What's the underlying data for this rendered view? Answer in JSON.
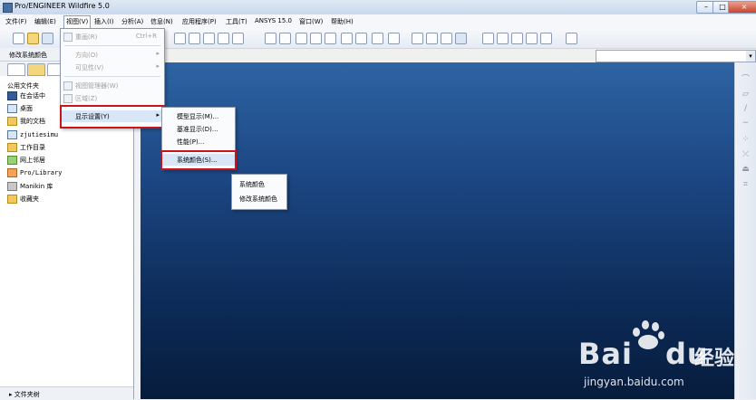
{
  "window": {
    "title": "Pro/ENGINEER Wildfire 5.0",
    "controls": [
      "–",
      "□",
      "×"
    ]
  },
  "menubar": [
    "文件(F)",
    "编辑(E)",
    "视图(V)",
    "插入(I)",
    "分析(A)",
    "信息(N)",
    "应用程序(P)",
    "工具(T)",
    "ANSYS 15.0",
    "窗口(W)",
    "帮助(H)"
  ],
  "left_panel": {
    "header": "修改系统颜色",
    "section": "公用文件夹",
    "items": [
      "在会话中",
      "桌面",
      "我的文档",
      "zjutiesimu",
      "工作目录",
      "网上邻居",
      "Pro/Library",
      "Manikin 库",
      "收藏夹"
    ],
    "footer": "▸ 文件夹树"
  },
  "view_menu": {
    "items": [
      {
        "label": "重画(R)",
        "shortcut": "Ctrl+R",
        "disabled": true
      },
      {
        "label": "方向(O)",
        "submenu": true,
        "disabled": true
      },
      {
        "label": "可见性(V)",
        "submenu": true,
        "disabled": true
      },
      {
        "label": "视图管理器(W)",
        "disabled": true
      },
      {
        "label": "区域(Z)",
        "disabled": true
      },
      {
        "label": "显示设置(Y)",
        "submenu": true,
        "disabled": false
      }
    ]
  },
  "display_submenu": {
    "items": [
      "模型显示(M)...",
      "基准显示(D)...",
      "性能(P)...",
      "系统颜色(S)..."
    ]
  },
  "tooltip_menu": {
    "items": [
      "系统颜色",
      "修改系统颜色"
    ]
  },
  "watermark": {
    "logo": "Bai",
    "logo_suffix": "du",
    "cn": "经验",
    "url": "jingyan.baidu.com"
  },
  "colors": {
    "highlight_box": "#c8141a",
    "graphics_top": "#2e64a3",
    "graphics_bottom": "#061c3c"
  }
}
